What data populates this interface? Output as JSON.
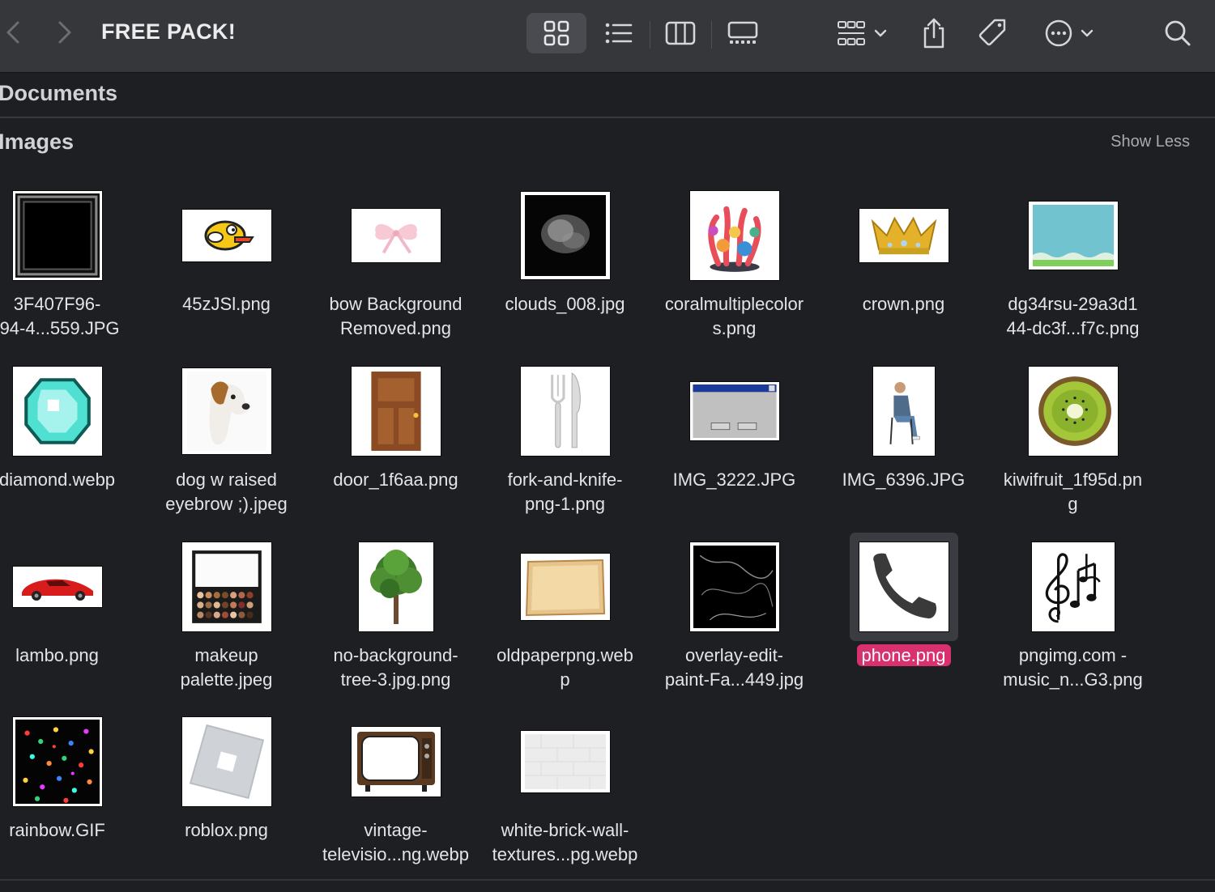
{
  "window": {
    "title": "FREE PACK!"
  },
  "sections": {
    "documents": {
      "title": "Documents"
    },
    "images": {
      "title": "Images",
      "show_less": "Show Less"
    }
  },
  "files": [
    {
      "name": "3F407F96-\n:94-4...559.JPG"
    },
    {
      "name": "45zJSl.png"
    },
    {
      "name": "bow Background\nRemoved.png"
    },
    {
      "name": "clouds_008.jpg"
    },
    {
      "name": "coralmultiplecolor\ns.png"
    },
    {
      "name": "crown.png"
    },
    {
      "name": "dg34rsu-29a3d1\n44-dc3f...f7c.png"
    },
    {
      "name": "diamond.webp"
    },
    {
      "name": "dog w raised\neyebrow ;).jpeg"
    },
    {
      "name": "door_1f6aa.png"
    },
    {
      "name": "fork-and-knife-\npng-1.png"
    },
    {
      "name": "IMG_3222.JPG"
    },
    {
      "name": "IMG_6396.JPG"
    },
    {
      "name": "kiwifruit_1f95d.pn\ng"
    },
    {
      "name": "lambo.png"
    },
    {
      "name": "makeup\npalette.jpeg"
    },
    {
      "name": "no-background-\ntree-3.jpg.png"
    },
    {
      "name": "oldpaperpng.web\np"
    },
    {
      "name": "overlay-edit-\npaint-Fa...449.jpg"
    },
    {
      "name": "phone.png"
    },
    {
      "name": "pngimg.com -\nmusic_n...G3.png"
    },
    {
      "name": "rainbow.GIF"
    },
    {
      "name": "roblox.png"
    },
    {
      "name": "vintage-\ntelevisio...ng.webp"
    },
    {
      "name": "white-brick-wall-\ntextures...pg.webp"
    }
  ],
  "selected_file": "phone.png",
  "colors": {
    "selection": "#d9316f",
    "background": "#1e1f22",
    "toolbar": "#36373b"
  },
  "icons": [
    "chevron-left-icon",
    "chevron-right-icon",
    "grid-view-icon",
    "list-view-icon",
    "column-view-icon",
    "gallery-view-icon",
    "group-icon",
    "share-icon",
    "tag-icon",
    "more-icon",
    "search-icon"
  ]
}
